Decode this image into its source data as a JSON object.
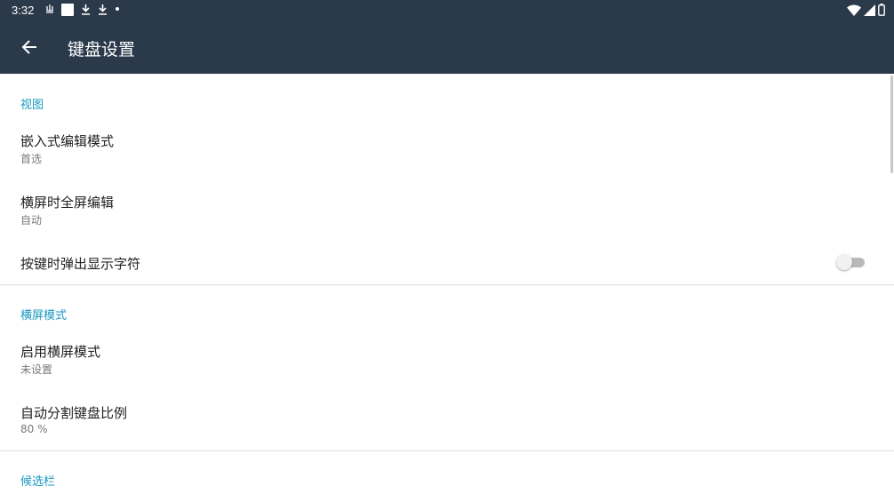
{
  "status_bar": {
    "time": "3:32",
    "left_icons": [
      "notification-icon",
      "square-icon",
      "download-icon",
      "download-icon",
      "dot-icon"
    ],
    "right_icons": [
      "wifi-icon",
      "signal-icon",
      "battery-icon"
    ]
  },
  "app_bar": {
    "title": "键盘设置",
    "back_icon": "arrow-back-icon"
  },
  "colors": {
    "bar_background": "#2b3a4b",
    "section_accent": "#1a98c2"
  },
  "sections": [
    {
      "header": "视图",
      "items": [
        {
          "title": "嵌入式编辑模式",
          "summary": "首选"
        },
        {
          "title": "横屏时全屏编辑",
          "summary": "自动"
        },
        {
          "title": "按键时弹出显示字符",
          "toggle": false
        }
      ]
    },
    {
      "header": "横屏模式",
      "items": [
        {
          "title": "启用横屏模式",
          "summary": "未设置"
        },
        {
          "title": "自动分割键盘比例",
          "summary": "80 %"
        }
      ]
    },
    {
      "header": "候选栏",
      "items": []
    }
  ]
}
